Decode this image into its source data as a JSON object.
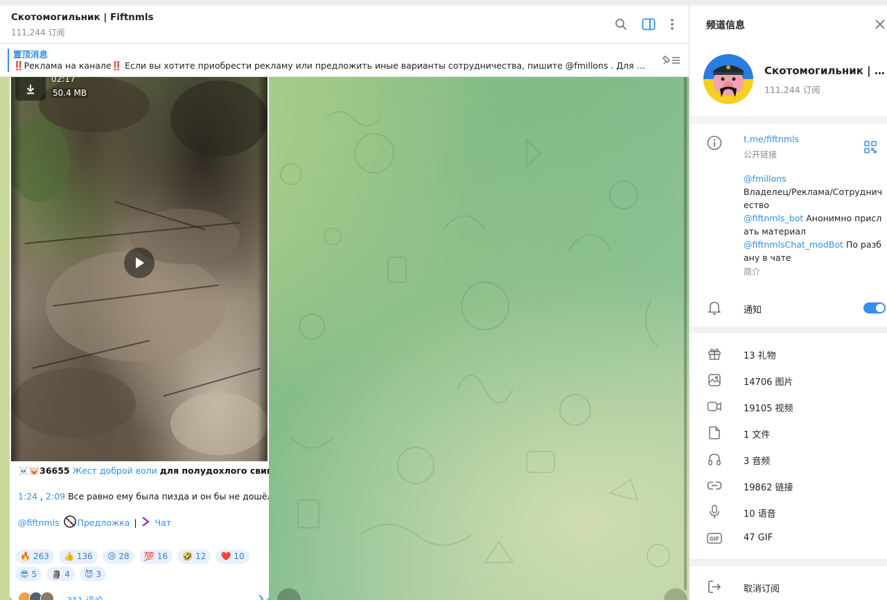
{
  "chat": {
    "title": "Скотомогильник | Fiftnmls",
    "subscribers": "111,244 订阅",
    "pinned_title": "置顶消息",
    "pinned_text": "‼️Реклама на канале‼️ Если вы хотите приобрести рекламу или предложить иные варианты сотрудничества, пишите @fmillons . Для начинающих каналов..."
  },
  "message": {
    "video_duration": "02:17",
    "video_size": "50.4 MB",
    "line1_prefix": "☠️🐷",
    "line1_number": "36655",
    "line1_link": "Жест доброй воли",
    "line1_rest": "для полудохлого свина",
    "line2_t1": "1:24",
    "line2_sep": " , ",
    "line2_t2": "2:09",
    "line2_text": "Все равно ему была пизда и он бы не дошёл",
    "line3_channel": "@fiftnmls",
    "line3_suggest": "Предложка",
    "line3_bar": "|",
    "line3_chat": "Чат",
    "comments": "311 评论",
    "reactions": [
      {
        "emoji": "🔥",
        "count": "263"
      },
      {
        "emoji": "👍",
        "count": "136"
      },
      {
        "emoji": "😢",
        "count": "28"
      },
      {
        "emoji": "💯",
        "count": "16"
      },
      {
        "emoji": "🤣",
        "count": "12"
      },
      {
        "emoji": "❤️",
        "count": "10"
      },
      {
        "emoji": "😎",
        "count": "5"
      },
      {
        "emoji": "🗿",
        "count": "4"
      },
      {
        "emoji": "😈",
        "count": "3"
      }
    ]
  },
  "panel": {
    "title": "频道信息",
    "channel_name": "Скотомогильник | Fiftnmls",
    "subscribers": "111,244 订阅",
    "link": "t.me/fiftnmls",
    "link_label": "公开链接",
    "about_owner_link": "@fmillons",
    "about_owner_text": "Владелец/Реклама/Сотрудничество",
    "about_bot_link": "@fiftnmls_bot",
    "about_bot_text": " Анонимно прислать материал",
    "about_mod_link": "@fiftnmlsChat_modBot",
    "about_mod_text": " По разбану в чате",
    "about_label": "简介",
    "notifications": "通知",
    "media": {
      "gifts": "13 礼物",
      "photos": "14706 图片",
      "videos": "19105 视频",
      "files": "1 文件",
      "audio": "3 音频",
      "links": "19862 链接",
      "voice": "10 语音",
      "gif": "47 GIF"
    },
    "unsubscribe": "取消订阅"
  },
  "colors": {
    "accent": "#3390ec",
    "chat_bg_green": "#8ec08a",
    "reaction_bg": "#e8f1fb"
  },
  "icons": {
    "search": "search-icon",
    "sidebar": "sidebar-toggle-icon",
    "more": "more-vertical-icon",
    "pin": "pin-list-icon",
    "download": "download-icon",
    "play": "play-icon",
    "close": "close-icon",
    "info": "info-icon",
    "qr": "qr-code-icon",
    "bell": "bell-icon",
    "gift": "gift-icon",
    "photo": "photo-icon",
    "video": "video-icon",
    "file": "file-icon",
    "audio": "headphones-icon",
    "link": "link-icon",
    "voice": "microphone-icon",
    "gif": "gif-icon",
    "leave": "leave-icon"
  }
}
